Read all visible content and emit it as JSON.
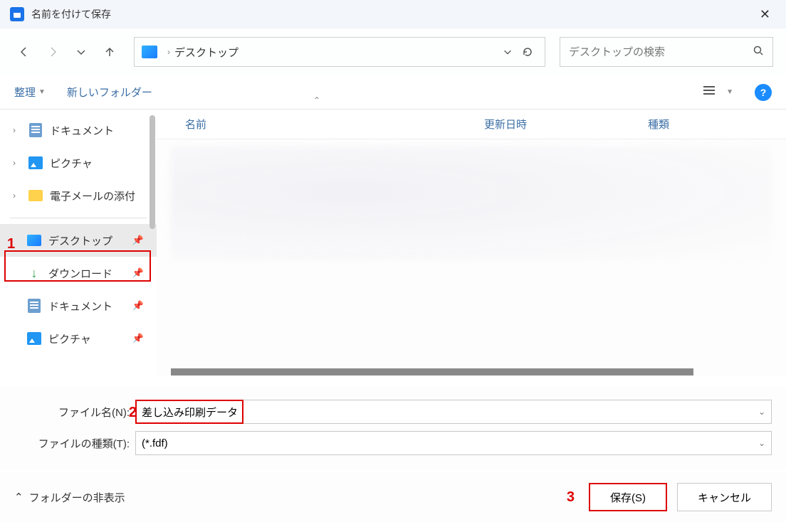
{
  "window": {
    "title": "名前を付けて保存"
  },
  "address": {
    "crumb": "デスクトップ",
    "sep": "›"
  },
  "search": {
    "placeholder": "デスクトップの検索"
  },
  "toolbar": {
    "organize": "整理",
    "newfolder": "新しいフォルダー",
    "help": "?"
  },
  "sidebar": {
    "items": [
      {
        "label": "ドキュメント"
      },
      {
        "label": "ピクチャ"
      },
      {
        "label": "電子メールの添付"
      },
      {
        "label": "デスクトップ"
      },
      {
        "label": "ダウンロード"
      },
      {
        "label": "ドキュメント"
      },
      {
        "label": "ピクチャ"
      }
    ]
  },
  "columns": {
    "name": "名前",
    "date": "更新日時",
    "type": "種類"
  },
  "form": {
    "filename_label": "ファイル名(N):",
    "filename_value": "差し込み印刷データ",
    "filetype_label": "ファイルの種類(T):",
    "filetype_value": "(*.fdf)"
  },
  "footer": {
    "hide_folders": "フォルダーの非表示",
    "save": "保存(S)",
    "cancel": "キャンセル"
  },
  "annotations": {
    "a1": "1",
    "a2": "2",
    "a3": "3"
  }
}
